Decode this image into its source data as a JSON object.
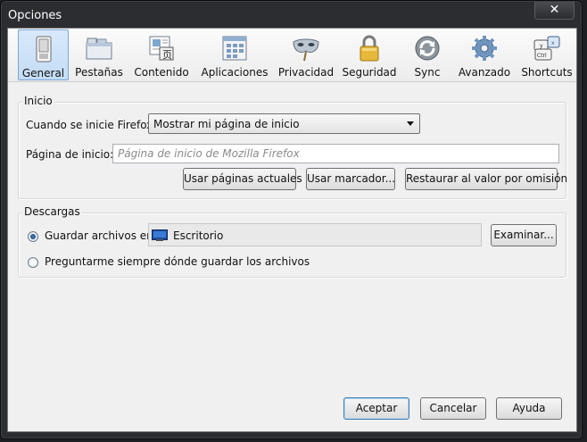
{
  "window": {
    "title": "Opciones",
    "close_symbol": "✕"
  },
  "toolbar": {
    "panes": [
      {
        "label": "General",
        "icon": "switch-icon"
      },
      {
        "label": "Pestañas",
        "icon": "tabs-icon"
      },
      {
        "label": "Contenido",
        "icon": "content-icon"
      },
      {
        "label": "Aplicaciones",
        "icon": "applications-icon"
      },
      {
        "label": "Privacidad",
        "icon": "mask-icon"
      },
      {
        "label": "Seguridad",
        "icon": "padlock-icon"
      },
      {
        "label": "Sync",
        "icon": "sync-icon"
      },
      {
        "label": "Avanzado",
        "icon": "gear-icon"
      },
      {
        "label": "Shortcuts",
        "icon": "keyboard-icon"
      }
    ],
    "selected": "General"
  },
  "startup": {
    "legend": "Inicio",
    "when_starts_label": "Cuando se inicie Firefox:",
    "when_starts_value": "Mostrar mi página de inicio",
    "homepage_label": "Página de inicio:",
    "homepage_placeholder": "Página de inicio de Mozilla Firefox",
    "use_current_button": "Usar páginas actuales",
    "use_bookmark_button": "Usar marcador...",
    "restore_default_button": "Restaurar al valor por omisión"
  },
  "downloads": {
    "legend": "Descargas",
    "save_to_label": "Guardar archivos en",
    "folder_name": "Escritorio",
    "browse_button": "Examinar...",
    "always_ask_label": "Preguntarme siempre dónde guardar los archivos",
    "selected_option": "save_to"
  },
  "footer": {
    "accept_button": "Aceptar",
    "cancel_button": "Cancelar",
    "help_button": "Ayuda"
  },
  "colors": {
    "selected_pane": "#c3dcf5",
    "chrome_dark": "#2b2d30",
    "dialog_bg": "#f0f0f0",
    "default_button_border": "#3c7fb1"
  }
}
